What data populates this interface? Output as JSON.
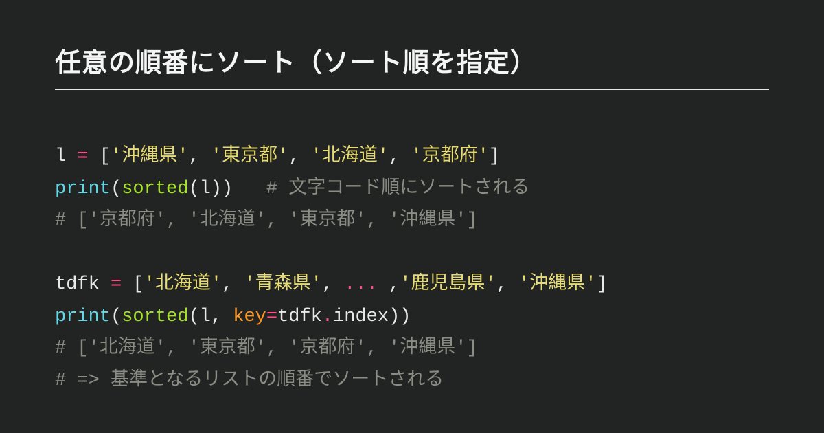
{
  "title": "任意の順番にソート（ソート順を指定）",
  "code": {
    "l1": {
      "var": "l ",
      "eq": "=",
      "open": " [",
      "s1": "'沖縄県'",
      "c1": ", ",
      "s2": "'東京都'",
      "c2": ", ",
      "s3": "'北海道'",
      "c3": ", ",
      "s4": "'京都府'",
      "close": "]"
    },
    "l2": {
      "print": "print",
      "open": "(",
      "sorted": "sorted",
      "args": "(l))   ",
      "comment": "# 文字コード順にソートされる"
    },
    "l3": {
      "comment": "# ['京都府', '北海道', '東京都', '沖縄県']"
    },
    "blank": "",
    "l5": {
      "var": "tdfk ",
      "eq": "=",
      "open": " [",
      "s1": "'北海道'",
      "c1": ", ",
      "s2": "'青森県'",
      "c2": ", ",
      "ell": "...",
      "c3": " ,",
      "s3": "'鹿児島県'",
      "c4": ", ",
      "s4": "'沖縄県'",
      "close": "]"
    },
    "l6": {
      "print": "print",
      "open": "(",
      "sorted": "sorted",
      "mid1": "(l, ",
      "key": "key",
      "eq": "=",
      "mid2": "tdfk",
      "dot": ".",
      "idx": "index))"
    },
    "l7": {
      "comment": "# ['北海道', '東京都', '京都府', '沖縄県']"
    },
    "l8": {
      "comment": "# => 基準となるリストの順番でソートされる"
    }
  }
}
